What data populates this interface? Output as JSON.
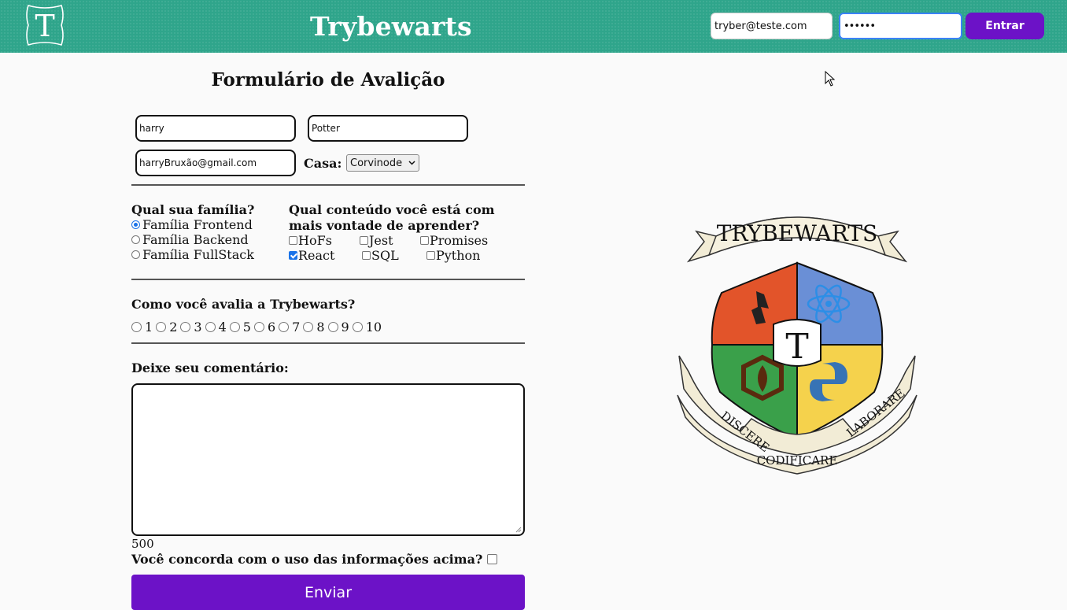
{
  "header": {
    "logo_letter": "T",
    "brand": "Trybewarts",
    "login_email_value": "tryber@teste.com",
    "login_password_value": "••••••",
    "login_button": "Entrar"
  },
  "form": {
    "title": "Formulário de Avalição",
    "first_name_value": "harry",
    "last_name_value": "Potter",
    "email_value": "harryBruxão@gmail.com",
    "house_label": "Casa:",
    "house_selected": "Corvinode",
    "family_question": "Qual sua família?",
    "families": [
      {
        "label": "Família Frontend",
        "selected": true
      },
      {
        "label": "Família Backend",
        "selected": false
      },
      {
        "label": "Família FullStack",
        "selected": false
      }
    ],
    "content_question_line1": "Qual conteúdo você está com",
    "content_question_line2": "mais vontade de aprender?",
    "subjects": [
      {
        "label": "HoFs",
        "checked": false
      },
      {
        "label": "Jest",
        "checked": false
      },
      {
        "label": "Promises",
        "checked": false
      },
      {
        "label": "React",
        "checked": true
      },
      {
        "label": "SQL",
        "checked": false
      },
      {
        "label": "Python",
        "checked": false
      }
    ],
    "rate_question": "Como você avalia a Trybewarts?",
    "rates": [
      "1",
      "2",
      "3",
      "4",
      "5",
      "6",
      "7",
      "8",
      "9",
      "10"
    ],
    "comment_label": "Deixe seu comentário:",
    "char_counter": "500",
    "agreement_label": "Você concorda com o uso das informações acima?",
    "submit_label": "Enviar"
  },
  "crest": {
    "banner_top": "TRYBEWARTS",
    "center_letter": "T",
    "motto_left": "DISCERE",
    "motto_center": "CODIFICARE",
    "motto_right": "LABORARE"
  },
  "colors": {
    "header_bg": "#2fa58b",
    "accent_purple": "#6c12c7",
    "crest_red": "#e2542a",
    "crest_blue": "#6a8fd6",
    "crest_green": "#3aa04a",
    "crest_yellow": "#f5d24c"
  }
}
